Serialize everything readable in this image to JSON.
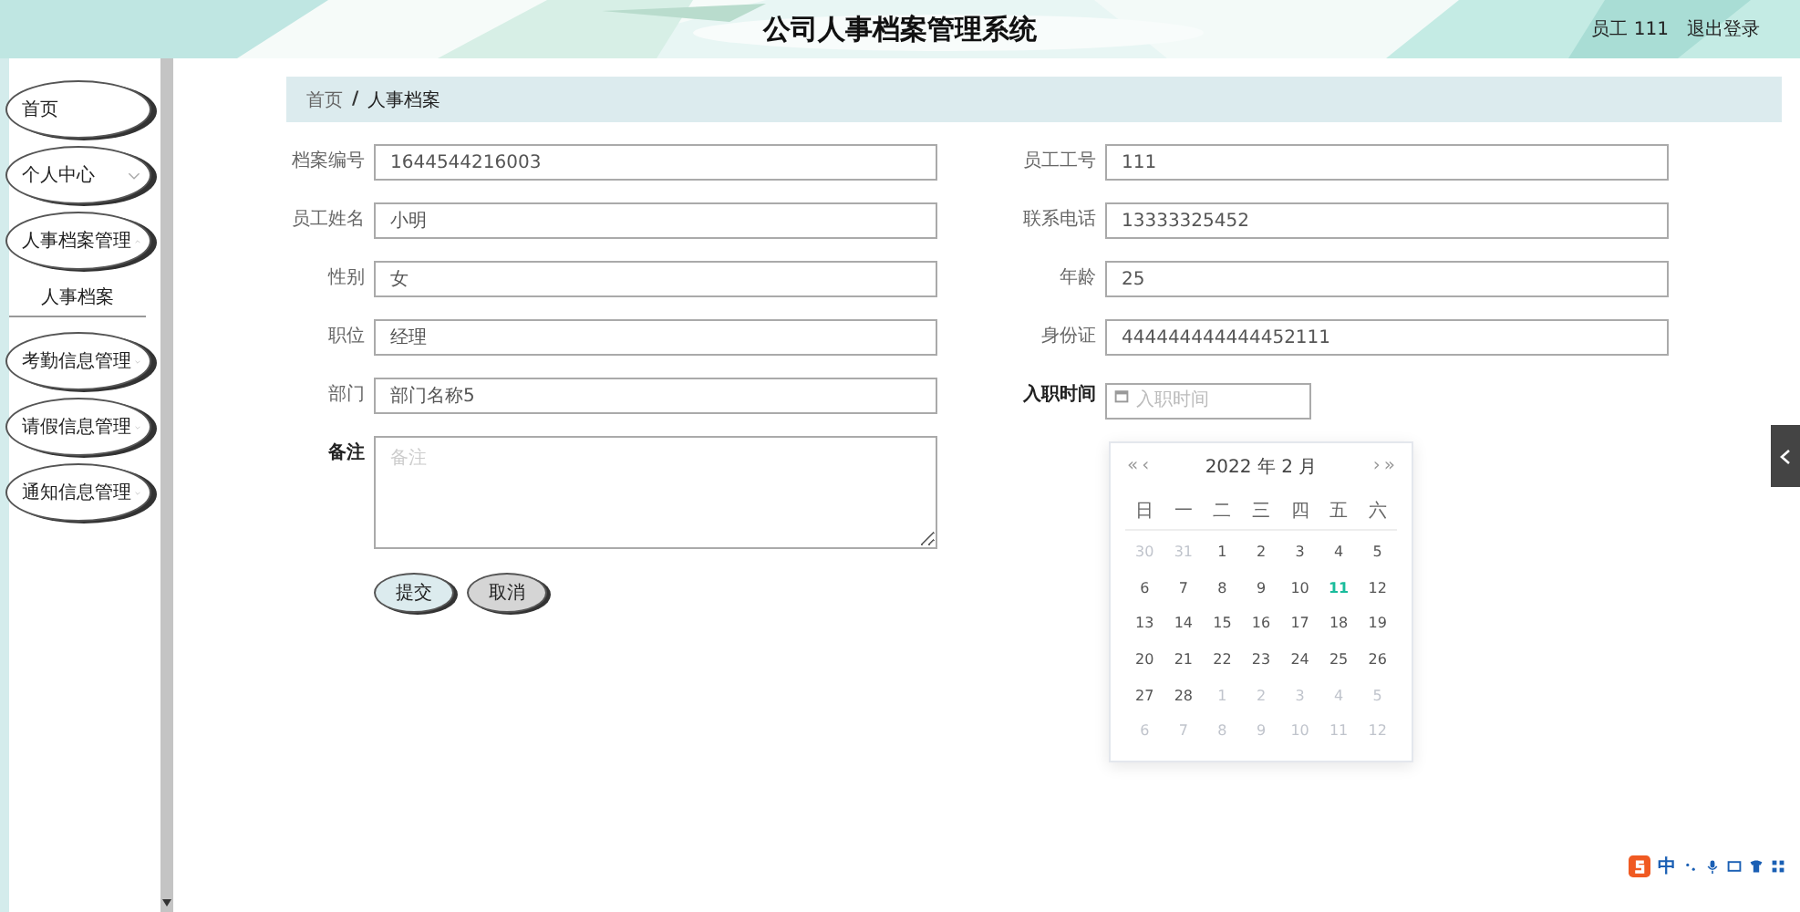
{
  "header": {
    "title": "公司人事档案管理系统",
    "user": "员工 111",
    "logout": "退出登录"
  },
  "sidebar": {
    "items": [
      {
        "label": "首页",
        "kind": "link"
      },
      {
        "label": "个人中心",
        "kind": "menu",
        "expanded": false
      },
      {
        "label": "人事档案管理",
        "kind": "menu",
        "expanded": true,
        "children": [
          {
            "label": "人事档案",
            "selected": true
          }
        ]
      },
      {
        "label": "考勤信息管理",
        "kind": "menu",
        "expanded": false
      },
      {
        "label": "请假信息管理",
        "kind": "menu",
        "expanded": false
      },
      {
        "label": "通知信息管理",
        "kind": "menu",
        "expanded": false
      }
    ]
  },
  "breadcrumb": {
    "items": [
      "首页",
      "人事档案"
    ],
    "separator": "/"
  },
  "form": {
    "left": [
      {
        "label": "档案编号",
        "kind": "text",
        "value": "1644544216003",
        "bold": false
      },
      {
        "label": "员工姓名",
        "kind": "text",
        "value": "小明",
        "bold": false
      },
      {
        "label": "性别",
        "kind": "text",
        "value": "女",
        "bold": false
      },
      {
        "label": "职位",
        "kind": "text",
        "value": "经理",
        "bold": false
      },
      {
        "label": "部门",
        "kind": "text",
        "value": "部门名称5",
        "bold": false
      },
      {
        "label": "备注",
        "kind": "textarea",
        "placeholder": "备注",
        "bold": true
      }
    ],
    "right": [
      {
        "label": "员工工号",
        "kind": "text",
        "value": "111",
        "bold": false
      },
      {
        "label": "联系电话",
        "kind": "text",
        "value": "13333325452",
        "bold": false
      },
      {
        "label": "年龄",
        "kind": "text",
        "value": "25",
        "bold": false
      },
      {
        "label": "身份证",
        "kind": "text",
        "value": "444444444444452111",
        "bold": false
      },
      {
        "label": "入职时间",
        "kind": "date",
        "placeholder": "入职时间",
        "bold": true
      }
    ],
    "buttons": [
      {
        "label": "提交",
        "kind": "primary"
      },
      {
        "label": "取消",
        "kind": "secondary"
      }
    ]
  },
  "calendar": {
    "prev_year": "«",
    "prev_month": "‹",
    "title": "2022 年  2 月",
    "next_month": "›",
    "next_year": "»",
    "weekdays": [
      "日",
      "一",
      "二",
      "三",
      "四",
      "五",
      "六"
    ],
    "weeks": [
      [
        {
          "day": "30",
          "muted": true,
          "selected": false
        },
        {
          "day": "31",
          "muted": true,
          "selected": false
        },
        {
          "day": "1",
          "muted": false,
          "selected": false
        },
        {
          "day": "2",
          "muted": false,
          "selected": false
        },
        {
          "day": "3",
          "muted": false,
          "selected": false
        },
        {
          "day": "4",
          "muted": false,
          "selected": false
        },
        {
          "day": "5",
          "muted": false,
          "selected": false
        }
      ],
      [
        {
          "day": "6",
          "muted": false,
          "selected": false
        },
        {
          "day": "7",
          "muted": false,
          "selected": false
        },
        {
          "day": "8",
          "muted": false,
          "selected": false
        },
        {
          "day": "9",
          "muted": false,
          "selected": false
        },
        {
          "day": "10",
          "muted": false,
          "selected": false
        },
        {
          "day": "11",
          "muted": false,
          "selected": true
        },
        {
          "day": "12",
          "muted": false,
          "selected": false
        }
      ],
      [
        {
          "day": "13",
          "muted": false,
          "selected": false
        },
        {
          "day": "14",
          "muted": false,
          "selected": false
        },
        {
          "day": "15",
          "muted": false,
          "selected": false
        },
        {
          "day": "16",
          "muted": false,
          "selected": false
        },
        {
          "day": "17",
          "muted": false,
          "selected": false
        },
        {
          "day": "18",
          "muted": false,
          "selected": false
        },
        {
          "day": "19",
          "muted": false,
          "selected": false
        }
      ],
      [
        {
          "day": "20",
          "muted": false,
          "selected": false
        },
        {
          "day": "21",
          "muted": false,
          "selected": false
        },
        {
          "day": "22",
          "muted": false,
          "selected": false
        },
        {
          "day": "23",
          "muted": false,
          "selected": false
        },
        {
          "day": "24",
          "muted": false,
          "selected": false
        },
        {
          "day": "25",
          "muted": false,
          "selected": false
        },
        {
          "day": "26",
          "muted": false,
          "selected": false
        }
      ],
      [
        {
          "day": "27",
          "muted": false,
          "selected": false
        },
        {
          "day": "28",
          "muted": false,
          "selected": false
        },
        {
          "day": "1",
          "muted": true,
          "selected": false
        },
        {
          "day": "2",
          "muted": true,
          "selected": false
        },
        {
          "day": "3",
          "muted": true,
          "selected": false
        },
        {
          "day": "4",
          "muted": true,
          "selected": false
        },
        {
          "day": "5",
          "muted": true,
          "selected": false
        }
      ],
      [
        {
          "day": "6",
          "muted": true,
          "selected": false
        },
        {
          "day": "7",
          "muted": true,
          "selected": false
        },
        {
          "day": "8",
          "muted": true,
          "selected": false
        },
        {
          "day": "9",
          "muted": true,
          "selected": false
        },
        {
          "day": "10",
          "muted": true,
          "selected": false
        },
        {
          "day": "11",
          "muted": true,
          "selected": false
        },
        {
          "day": "12",
          "muted": true,
          "selected": false
        }
      ]
    ]
  },
  "ime_toolbar": {
    "mode": "中"
  }
}
